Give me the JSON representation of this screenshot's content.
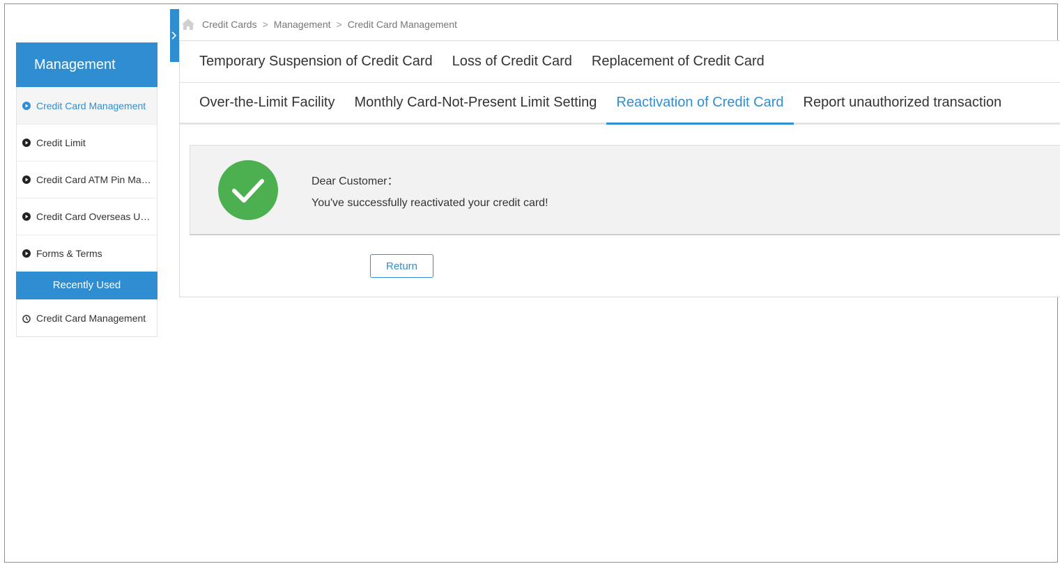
{
  "breadcrumb": {
    "items": [
      "Credit Cards",
      "Management",
      "Credit Card Management"
    ],
    "separator": ">"
  },
  "sidebar": {
    "title": "Management",
    "items": [
      {
        "label": "Credit Card Management",
        "active": true
      },
      {
        "label": "Credit Limit",
        "active": false
      },
      {
        "label": "Credit Card ATM Pin Management",
        "active": false
      },
      {
        "label": "Credit Card Overseas Usage",
        "active": false
      },
      {
        "label": "Forms & Terms",
        "active": false
      }
    ],
    "recent_title": "Recently Used",
    "recent_items": [
      {
        "label": "Credit Card Management"
      }
    ]
  },
  "tabs": {
    "row1": [
      {
        "label": "Temporary Suspension of Credit Card"
      },
      {
        "label": "Loss of Credit Card"
      },
      {
        "label": "Replacement of Credit Card"
      }
    ],
    "row2": [
      {
        "label": "Over-the-Limit Facility"
      },
      {
        "label": "Monthly Card-Not-Present Limit Setting"
      },
      {
        "label": "Reactivation of Credit Card",
        "active": true
      },
      {
        "label": "Report unauthorized transaction"
      }
    ]
  },
  "result": {
    "icon": "success-check-icon",
    "greeting": "Dear Customer：",
    "message": "You've successfully reactivated your credit card!",
    "return_label": "Return"
  },
  "colors": {
    "accent": "#2f8ed1",
    "success": "#4caf50"
  }
}
